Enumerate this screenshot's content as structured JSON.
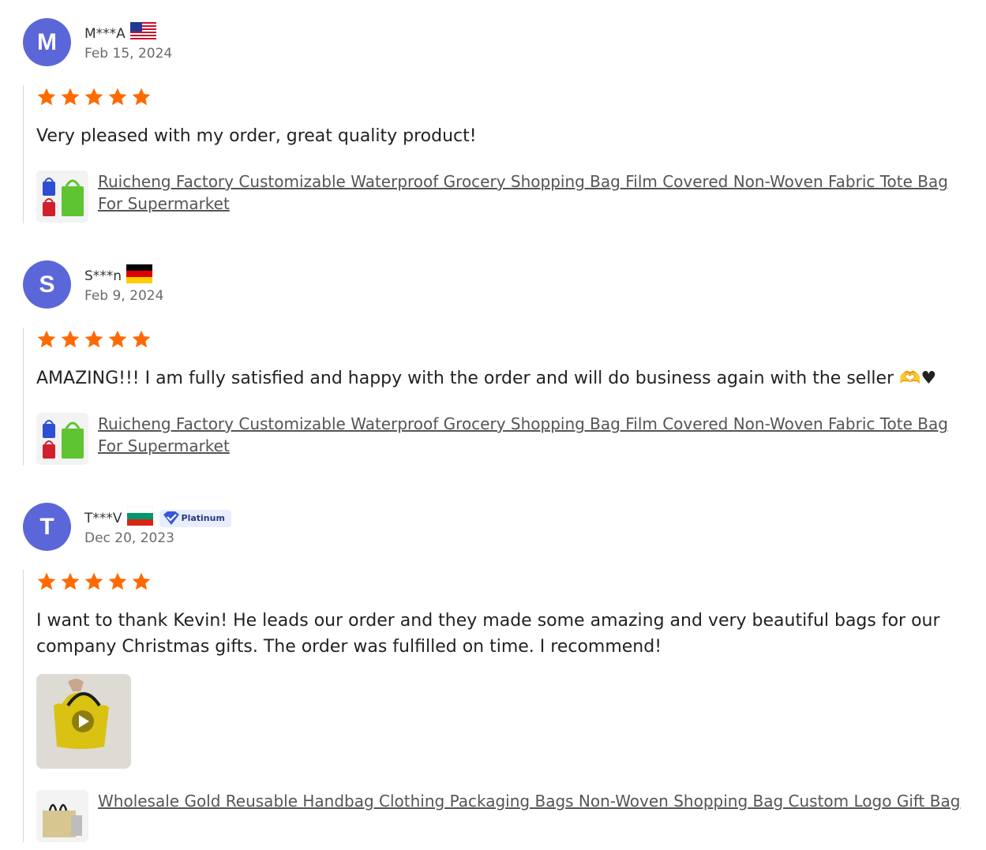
{
  "colors": {
    "accent_star": "#ff6a00",
    "avatar": "#5b67d8",
    "link": "#555555"
  },
  "reviews": [
    {
      "initial": "M",
      "name": "M***A",
      "flag": "us-flag",
      "date": "Feb 15, 2024",
      "rating": 5,
      "text": "Very pleased with my order, great quality product!",
      "product_title": "Ruicheng Factory Customizable Waterproof Grocery Shopping Bag Film Covered Non-Woven Fabric Tote Bag For Supermarket"
    },
    {
      "initial": "S",
      "name": "S***n",
      "flag": "germany-flag",
      "date": "Feb 9, 2024",
      "rating": 5,
      "text": "AMAZING!!! I am fully satisfied and happy with the order and will do business again with the seller 🫶♥",
      "product_title": "Ruicheng Factory Customizable Waterproof Grocery Shopping Bag Film Covered Non-Woven Fabric Tote Bag For Supermarket"
    },
    {
      "initial": "T",
      "name": "T***V",
      "flag": "bulgaria-flag",
      "badge": "Platinum",
      "date": "Dec 20, 2023",
      "rating": 5,
      "text": "I want to thank Kevin! He leads our order and they made some amazing and very beautiful bags for our company Christmas gifts. The order was fulfilled on time. I recommend!",
      "media": "video-thumbnail",
      "product_title": "Wholesale Gold Reusable Handbag Clothing Packaging Bags Non-Woven Shopping Bag Custom Logo Gift Bag"
    }
  ]
}
